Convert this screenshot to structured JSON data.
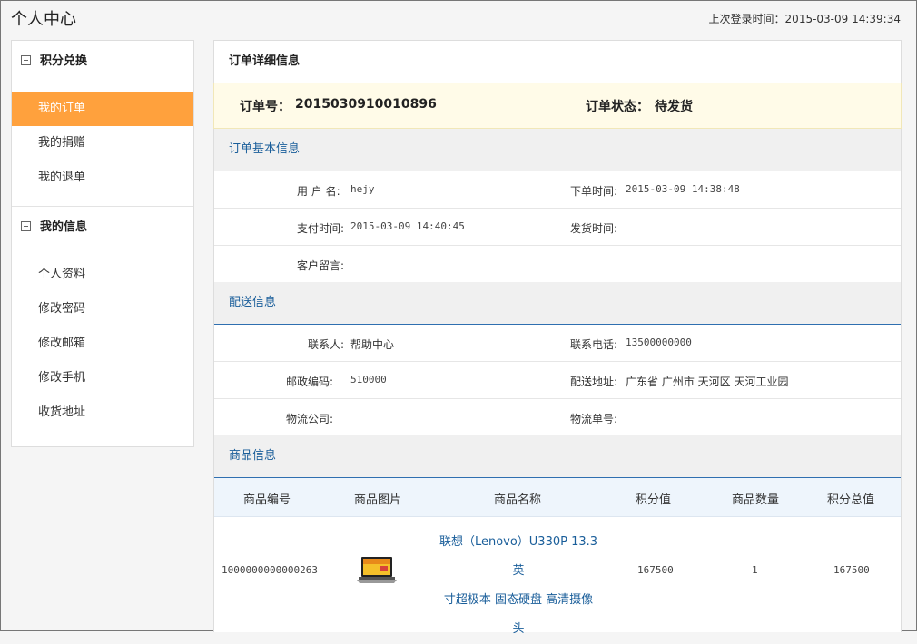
{
  "header": {
    "title": "个人中心",
    "last_login_label": "上次登录时间：",
    "last_login_value": "2015-03-09 14:39:34"
  },
  "sidebar": {
    "groups": [
      {
        "title": "积分兑换",
        "items": [
          {
            "label": "我的订单",
            "active": true
          },
          {
            "label": "我的捐赠"
          },
          {
            "label": "我的退单"
          }
        ]
      },
      {
        "title": "我的信息",
        "items": [
          {
            "label": "个人资料"
          },
          {
            "label": "修改密码"
          },
          {
            "label": "修改邮箱"
          },
          {
            "label": "修改手机"
          },
          {
            "label": "收货地址"
          }
        ]
      }
    ]
  },
  "order": {
    "panel_title": "订单详细信息",
    "number_label": "订单号：",
    "number_value": "2015030910010896",
    "status_label": "订单状态：",
    "status_value": "待发货",
    "status_color": "#3a9a1c"
  },
  "basic": {
    "section_title": "订单基本信息",
    "username_label": "用 户 名:",
    "username_value": "hejy",
    "order_time_label": "下单时间:",
    "order_time_value": "2015-03-09 14:38:48",
    "pay_time_label": "支付时间:",
    "pay_time_value": "2015-03-09 14:40:45",
    "ship_time_label": "发货时间:",
    "ship_time_value": "",
    "remark_label": "客户留言:",
    "remark_value": ""
  },
  "delivery": {
    "section_title": "配送信息",
    "contact_label": "联系人:",
    "contact_value": "帮助中心",
    "phone_label": "联系电话:",
    "phone_value": "13500000000",
    "zip_label": "邮政编码:",
    "zip_value": "510000",
    "address_label": "配送地址:",
    "address_value": "广东省 广州市 天河区 天河工业园",
    "company_label": "物流公司:",
    "company_value": "",
    "tracking_label": "物流单号:",
    "tracking_value": ""
  },
  "goods": {
    "section_title": "商品信息",
    "columns": [
      "商品编号",
      "商品图片",
      "商品名称",
      "积分值",
      "商品数量",
      "积分总值"
    ],
    "rows": [
      {
        "id": "1000000000000263",
        "image_icon": "laptop-image",
        "name_line1": "联想（Lenovo）U330P 13.3英",
        "name_line2": "寸超极本 固态硬盘 高清摄像",
        "name_line3": "头",
        "points": "167500",
        "quantity": "1",
        "total": "167500"
      }
    ]
  },
  "colors": {
    "accent_active": "#ffa13d",
    "link_blue": "#1a5e9a",
    "section_bg": "#f0f0f0"
  }
}
